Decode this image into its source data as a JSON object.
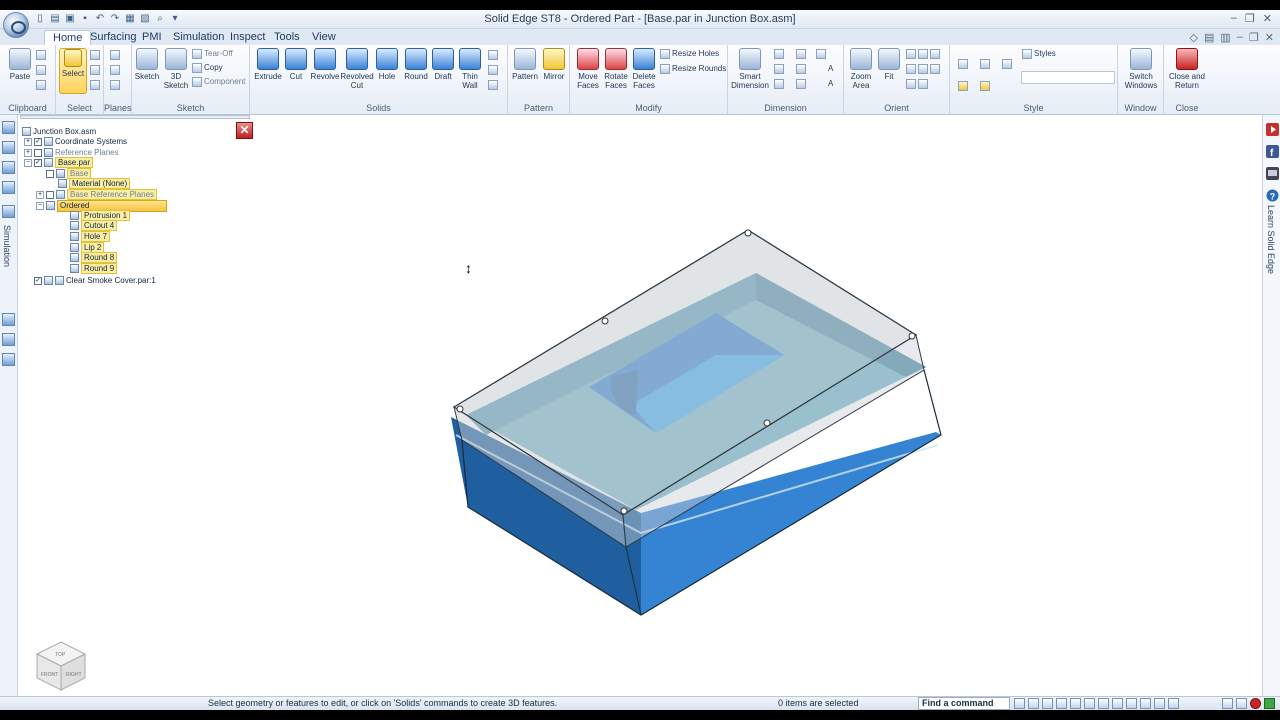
{
  "window": {
    "title": "Solid Edge ST8 - Ordered Part - [Base.par in Junction Box.asm]"
  },
  "tabs": [
    {
      "label": "Home",
      "active": true
    },
    {
      "label": "Surfacing"
    },
    {
      "label": "PMI"
    },
    {
      "label": "Simulation"
    },
    {
      "label": "Inspect"
    },
    {
      "label": "Tools"
    },
    {
      "label": "View"
    }
  ],
  "ribbon": {
    "clipboard": {
      "paste": "Paste",
      "group": "Clipboard"
    },
    "select": {
      "select": "Select",
      "group": "Select"
    },
    "planes": {
      "group": "Planes"
    },
    "sketch": {
      "sketch": "Sketch",
      "sketch3d": "3D Sketch",
      "tearoff": "Tear-Off",
      "copy": "Copy",
      "component": "Component",
      "group": "Sketch"
    },
    "solids": {
      "extrude": "Extrude",
      "cut": "Cut",
      "revolve": "Revolve",
      "revolved_cut": "Revolved Cut",
      "hole": "Hole",
      "round": "Round",
      "draft": "Draft",
      "thin_wall": "Thin Wall",
      "group": "Solids"
    },
    "pattern": {
      "pattern": "Pattern",
      "mirror": "Mirror",
      "group": "Pattern"
    },
    "modify": {
      "move_faces": "Move Faces",
      "rotate_faces": "Rotate Faces",
      "delete_faces": "Delete Faces",
      "resize_holes": "Resize Holes",
      "resize_rounds": "Resize Rounds",
      "group": "Modify"
    },
    "dimension": {
      "smart_dimension": "Smart Dimension",
      "group": "Dimension"
    },
    "orient": {
      "zoom_area": "Zoom Area",
      "fit": "Fit",
      "group": "Orient"
    },
    "style": {
      "styles": "Styles",
      "group": "Style"
    },
    "window": {
      "switch_windows": "Switch Windows",
      "group": "Window"
    },
    "close": {
      "close_return": "Close and Return",
      "group": "Close"
    }
  },
  "left_strip": {
    "label": "Simulation"
  },
  "right_strip": {
    "label": "Learn Solid Edge"
  },
  "pathfinder": {
    "items": [
      {
        "label": "Junction Box.asm"
      },
      {
        "label": "Coordinate Systems"
      },
      {
        "label": "Reference Planes"
      },
      {
        "label": "Base.par"
      },
      {
        "label": "Base"
      },
      {
        "label": "Material (None)"
      },
      {
        "label": "Base Reference Planes"
      },
      {
        "label": "Ordered"
      },
      {
        "label": "Protrusion 1"
      },
      {
        "label": "Cutout 4"
      },
      {
        "label": "Hole 7"
      },
      {
        "label": "Lip 2"
      },
      {
        "label": "Round 8"
      },
      {
        "label": "Round 9"
      },
      {
        "label": "Clear Smoke Cover.par:1"
      }
    ]
  },
  "viewcube": {
    "front": "FRONT",
    "right": "RIGHT",
    "top": "TOP"
  },
  "status": {
    "prompt": "Select geometry or features to edit, or click on 'Solids' commands to create 3D features.",
    "items_selected": "0 items are selected",
    "find": "Find a command"
  },
  "colors": {
    "box_blue": "#2f7fd0",
    "cover_smoke": "#c9ced4",
    "highlight": "#f5c443"
  }
}
